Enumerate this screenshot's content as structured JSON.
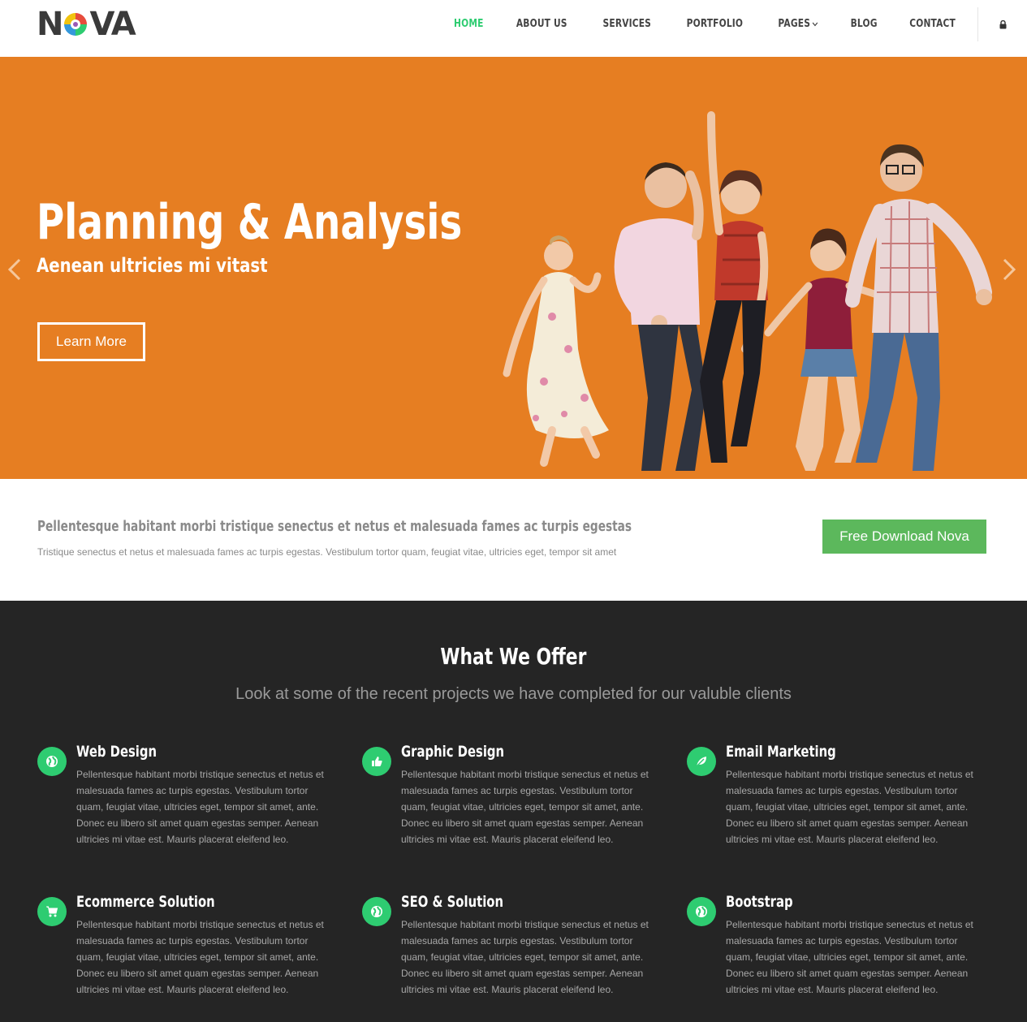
{
  "brand": {
    "logo_text_left": "N",
    "logo_text_right": "VA"
  },
  "nav": {
    "items": [
      {
        "label": "HOME",
        "active": true
      },
      {
        "label": "ABOUT US"
      },
      {
        "label": "SERVICES"
      },
      {
        "label": "PORTFOLIO"
      },
      {
        "label": "PAGES"
      },
      {
        "label": "BLOG"
      },
      {
        "label": "CONTACT"
      }
    ],
    "lock_icon": "lock-icon",
    "pages_caret_icon": "chevron-down-icon"
  },
  "hero": {
    "title": "Planning & Analysis",
    "subtitle": "Aenean ultricies mi vitast",
    "button_label": "Learn More",
    "background_color": "#e67e22"
  },
  "callout": {
    "title": "Pellentesque habitant morbi tristique senectus et netus et malesuada fames ac turpis egestas",
    "text": "Tristique senectus et netus et malesuada fames ac turpis egestas. Vestibulum tortor quam, feugiat vitae, ultricies eget, tempor sit amet",
    "button_label": "Free Download Nova",
    "button_color": "#5cb85c"
  },
  "services": {
    "heading": "What We Offer",
    "subheading": "Look at some of the recent projects we have completed for our valuble clients",
    "accent_color": "#2ecc71",
    "items": [
      {
        "title": "Web Design",
        "icon": "globe-icon",
        "body": "Pellentesque habitant morbi tristique senectus et netus et malesuada fames ac turpis egestas. Vestibulum tortor quam, feugiat vitae, ultricies eget, tempor sit amet, ante. Donec eu libero sit amet quam egestas semper. Aenean ultricies mi vitae est. Mauris placerat eleifend leo."
      },
      {
        "title": "Graphic Design",
        "icon": "thumbs-up-icon",
        "body": "Pellentesque habitant morbi tristique senectus et netus et malesuada fames ac turpis egestas. Vestibulum tortor quam, feugiat vitae, ultricies eget, tempor sit amet, ante. Donec eu libero sit amet quam egestas semper. Aenean ultricies mi vitae est. Mauris placerat eleifend leo."
      },
      {
        "title": "Email Marketing",
        "icon": "leaf-icon",
        "body": "Pellentesque habitant morbi tristique senectus et netus et malesuada fames ac turpis egestas. Vestibulum tortor quam, feugiat vitae, ultricies eget, tempor sit amet, ante. Donec eu libero sit amet quam egestas semper. Aenean ultricies mi vitae est. Mauris placerat eleifend leo."
      },
      {
        "title": "Ecommerce Solution",
        "icon": "cart-icon",
        "body": "Pellentesque habitant morbi tristique senectus et netus et malesuada fames ac turpis egestas. Vestibulum tortor quam, feugiat vitae, ultricies eget, tempor sit amet, ante. Donec eu libero sit amet quam egestas semper. Aenean ultricies mi vitae est. Mauris placerat eleifend leo."
      },
      {
        "title": "SEO & Solution",
        "icon": "globe-icon",
        "body": "Pellentesque habitant morbi tristique senectus et netus et malesuada fames ac turpis egestas. Vestibulum tortor quam, feugiat vitae, ultricies eget, tempor sit amet, ante. Donec eu libero sit amet quam egestas semper. Aenean ultricies mi vitae est. Mauris placerat eleifend leo."
      },
      {
        "title": "Bootstrap",
        "icon": "globe-icon",
        "body": "Pellentesque habitant morbi tristique senectus et netus et malesuada fames ac turpis egestas. Vestibulum tortor quam, feugiat vitae, ultricies eget, tempor sit amet, ante. Donec eu libero sit amet quam egestas semper. Aenean ultricies mi vitae est. Mauris placerat eleifend leo."
      }
    ]
  }
}
